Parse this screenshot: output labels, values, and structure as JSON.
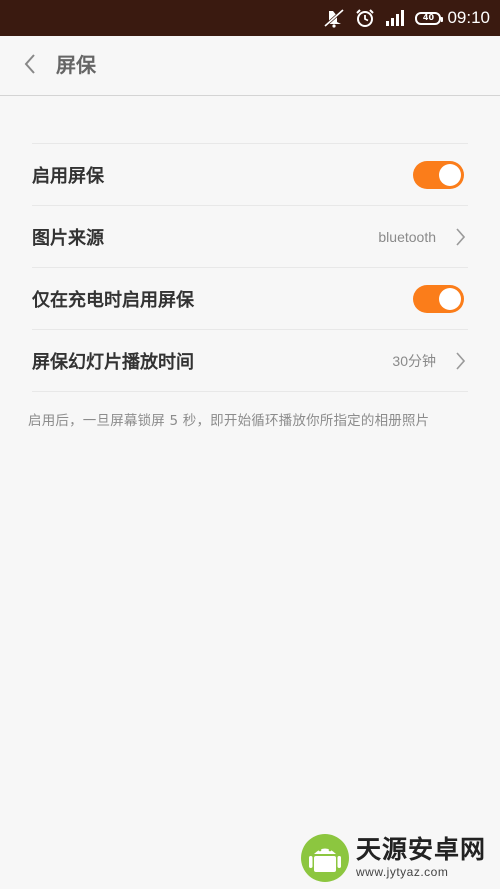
{
  "status_bar": {
    "background": "#3a1a10",
    "icons": [
      "mute-icon",
      "alarm-icon",
      "signal-icon",
      "battery-icon"
    ],
    "battery_level": "40",
    "time": "09:10"
  },
  "header": {
    "back_icon": "chevron-left-icon",
    "title": "屏保"
  },
  "settings": {
    "accent": "#fb7d1a",
    "rows": [
      {
        "label": "启用屏保",
        "type": "toggle",
        "on": true
      },
      {
        "label": "图片来源",
        "type": "link",
        "value": "bluetooth"
      },
      {
        "label": "仅在充电时启用屏保",
        "type": "toggle",
        "on": true
      },
      {
        "label": "屏保幻灯片播放时间",
        "type": "link",
        "value": "30分钟"
      }
    ]
  },
  "note": "启用后，一旦屏幕锁屏 5 秒，即开始循环播放你所指定的相册照片",
  "watermark": {
    "name": "天源安卓网",
    "url": "www.jytyaz.com"
  }
}
